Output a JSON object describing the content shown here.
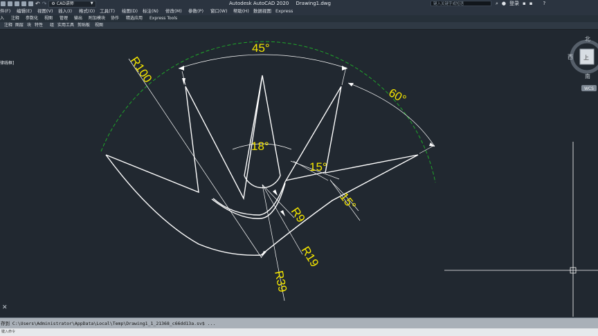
{
  "titlebar": {
    "workspace": "CAD讲师",
    "app_name": "Autodesk AutoCAD 2020",
    "file_name": "Drawing1.dwg",
    "search_placeholder": "键入关键字或短语",
    "login": "登录"
  },
  "menu": [
    "件(F)",
    "编辑(E)",
    "视图(V)",
    "插入(I)",
    "格式(O)",
    "工具(T)",
    "绘图(D)",
    "标注(N)",
    "修改(M)",
    "参数(P)",
    "窗口(W)",
    "帮助(H)",
    "数据视图",
    "Express"
  ],
  "ribbon_tabs": [
    "入",
    "注释",
    "参数化",
    "视图",
    "管理",
    "输出",
    "附加模块",
    "协作",
    "精选应用",
    "Express Tools"
  ],
  "panels": [
    "注释",
    "图层",
    "块",
    "特性",
    "组",
    "实用工具",
    "剪贴板",
    "视图"
  ],
  "doc_tab": "律线框]",
  "dimensions": {
    "angle_top": "45°",
    "angle_right": "60°",
    "angle_center": "18°",
    "angle_inner": "15°",
    "angle_outer": "15°",
    "radius_outer": "R100",
    "radius_r9": "R9",
    "radius_r19": "R19",
    "radius_r39": "R39"
  },
  "viewcube": {
    "north": "北",
    "west": "西",
    "south": "南",
    "top": "上",
    "wcs": "WCS"
  },
  "command_line": {
    "text": "存到 C:\\Users\\Administrator\\AppData\\Local\\Temp\\Drawing1_1_21368_c66dd13a.sv$ ..."
  },
  "status": "键入命令",
  "colors": {
    "canvas_bg": "#212830",
    "dimension": "#f5e600",
    "geometry": "#ffffff",
    "center_line": "#1fa82a"
  }
}
